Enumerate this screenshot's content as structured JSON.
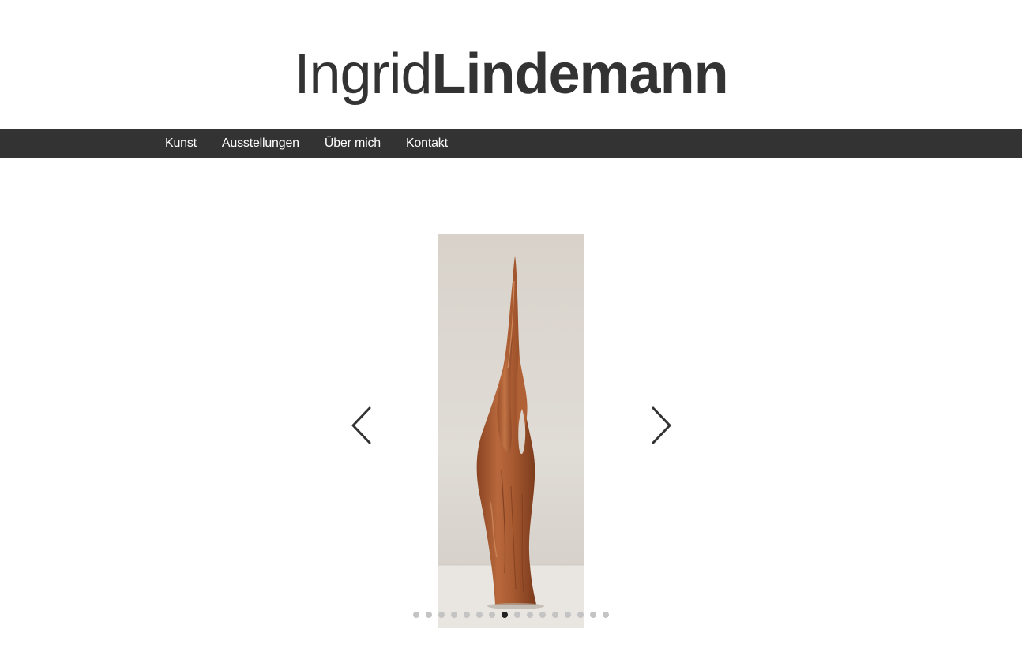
{
  "site": {
    "logo_first": "Ingrid",
    "logo_last": "Lindemann"
  },
  "nav": {
    "items": [
      {
        "label": "Kunst"
      },
      {
        "label": "Ausstellungen"
      },
      {
        "label": "Über mich"
      },
      {
        "label": "Kontakt"
      }
    ]
  },
  "slider": {
    "total_slides": 16,
    "active_slide": 8,
    "image_subject": "wood-sculpture",
    "prev_icon": "chevron-left-icon",
    "next_icon": "chevron-right-icon"
  },
  "colors": {
    "text": "#333333",
    "nav_bg": "#333333",
    "nav_text": "#ffffff",
    "dot_inactive": "#c4c4c4",
    "dot_active": "#222222"
  }
}
